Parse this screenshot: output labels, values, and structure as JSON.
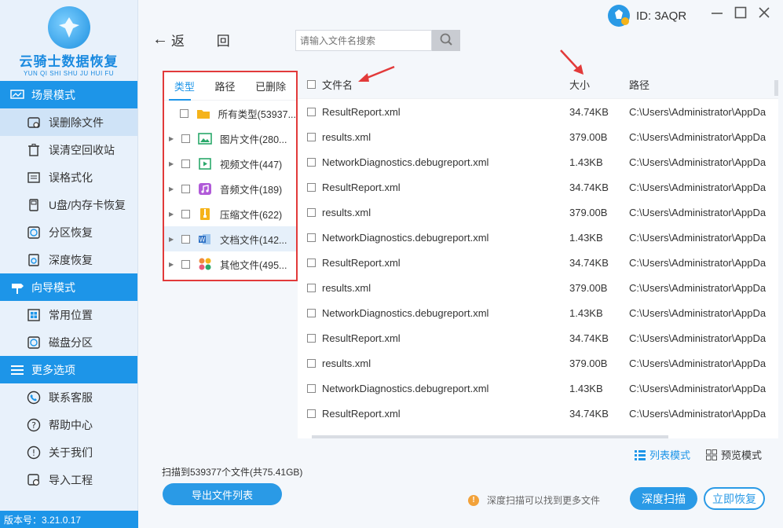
{
  "app": {
    "logo_title": "云骑士数据恢复",
    "logo_subtitle": "YUN QI SHI SHU JU HUI FU",
    "version": "版本号：3.21.0.17",
    "user_id": "ID: 3AQR"
  },
  "sidebar": {
    "sections": [
      {
        "title": "场景模式",
        "items": [
          "误删除文件",
          "误清空回收站",
          "误格式化",
          "U盘/内存卡恢复",
          "分区恢复",
          "深度恢复"
        ]
      },
      {
        "title": "向导模式",
        "items": [
          "常用位置",
          "磁盘分区"
        ]
      },
      {
        "title": "更多选项",
        "items": [
          "联系客服",
          "帮助中心",
          "关于我们",
          "导入工程"
        ]
      }
    ],
    "active_item": "误删除文件"
  },
  "toolbar": {
    "back_label": "返 回",
    "search_placeholder": "请输入文件名搜索"
  },
  "type_panel": {
    "tabs": [
      "类型",
      "路径",
      "已删除"
    ],
    "rows": [
      {
        "label": "所有类型(53937...",
        "icon": "folder-icon"
      },
      {
        "label": "图片文件(280...",
        "icon": "image-icon"
      },
      {
        "label": "视频文件(447)",
        "icon": "video-icon"
      },
      {
        "label": "音频文件(189)",
        "icon": "music-icon"
      },
      {
        "label": "压缩文件(622)",
        "icon": "archive-icon"
      },
      {
        "label": "文档文件(142...",
        "icon": "document-icon"
      },
      {
        "label": "其他文件(495...",
        "icon": "other-files-icon"
      }
    ]
  },
  "table": {
    "headers": {
      "name": "文件名",
      "size": "大小",
      "path": "路径"
    },
    "rows": [
      {
        "name": "ResultReport.xml",
        "size": "34.74KB",
        "path": "C:\\Users\\Administrator\\AppDa"
      },
      {
        "name": "results.xml",
        "size": "379.00B",
        "path": "C:\\Users\\Administrator\\AppDa"
      },
      {
        "name": "NetworkDiagnostics.debugreport.xml",
        "size": "1.43KB",
        "path": "C:\\Users\\Administrator\\AppDa"
      },
      {
        "name": "ResultReport.xml",
        "size": "34.74KB",
        "path": "C:\\Users\\Administrator\\AppDa"
      },
      {
        "name": "results.xml",
        "size": "379.00B",
        "path": "C:\\Users\\Administrator\\AppDa"
      },
      {
        "name": "NetworkDiagnostics.debugreport.xml",
        "size": "1.43KB",
        "path": "C:\\Users\\Administrator\\AppDa"
      },
      {
        "name": "ResultReport.xml",
        "size": "34.74KB",
        "path": "C:\\Users\\Administrator\\AppDa"
      },
      {
        "name": "results.xml",
        "size": "379.00B",
        "path": "C:\\Users\\Administrator\\AppDa"
      },
      {
        "name": "NetworkDiagnostics.debugreport.xml",
        "size": "1.43KB",
        "path": "C:\\Users\\Administrator\\AppDa"
      },
      {
        "name": "ResultReport.xml",
        "size": "34.74KB",
        "path": "C:\\Users\\Administrator\\AppDa"
      },
      {
        "name": "results.xml",
        "size": "379.00B",
        "path": "C:\\Users\\Administrator\\AppDa"
      },
      {
        "name": "NetworkDiagnostics.debugreport.xml",
        "size": "1.43KB",
        "path": "C:\\Users\\Administrator\\AppDa"
      },
      {
        "name": "ResultReport.xml",
        "size": "34.74KB",
        "path": "C:\\Users\\Administrator\\AppDa"
      }
    ]
  },
  "view_modes": {
    "list": "列表模式",
    "preview": "预览模式"
  },
  "footer": {
    "scan_info": "扫描到539377个文件(共75.41GB)",
    "export_label": "导出文件列表",
    "tip": "深度扫描可以找到更多文件",
    "deep_scan_label": "深度扫描",
    "recover_label": "立即恢复"
  },
  "colors": {
    "accent": "#1d95e8",
    "annotation": "#e23a3a"
  }
}
